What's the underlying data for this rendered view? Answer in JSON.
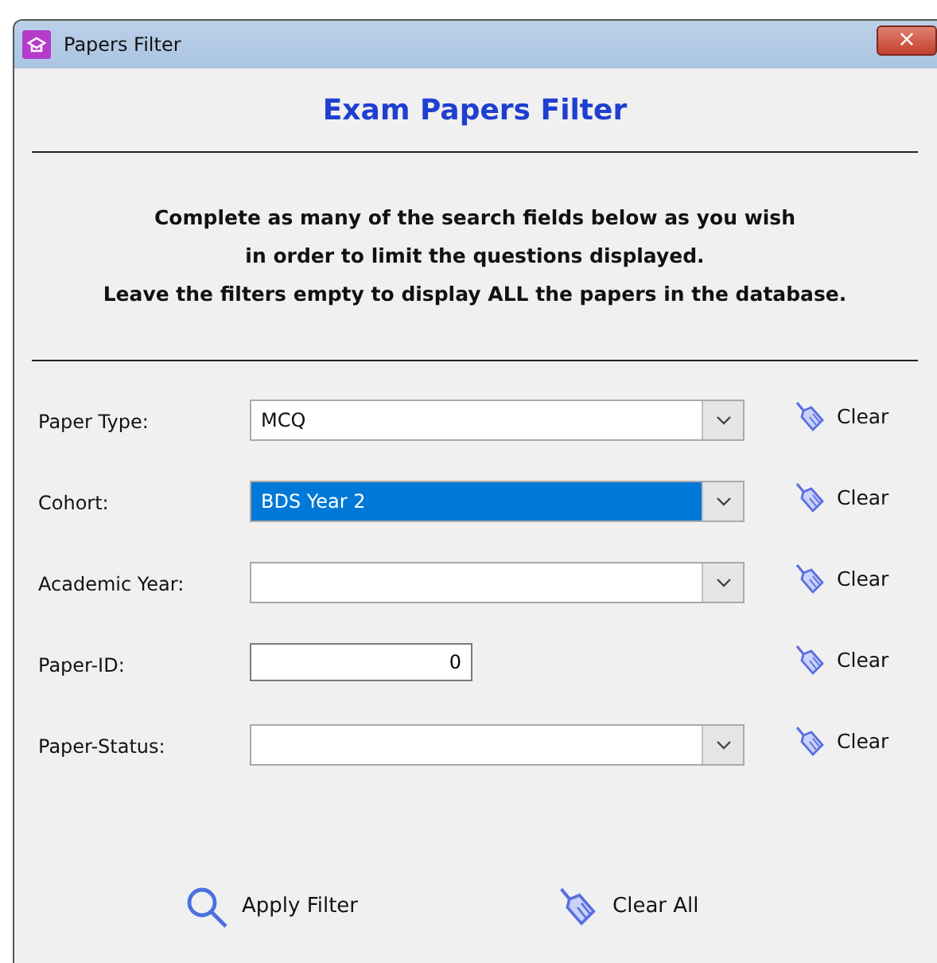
{
  "window": {
    "title": "Papers Filter",
    "close": "×"
  },
  "heading": "Exam Papers Filter",
  "instructions": [
    "Complete as many of the search fields below as you wish",
    "in order to limit the questions displayed.",
    "Leave the filters empty to display ALL the papers in the database."
  ],
  "fields": [
    {
      "label": "Paper Type:",
      "kind": "combo",
      "value": "MCQ",
      "selected": false,
      "clear": "Clear"
    },
    {
      "label": "Cohort:",
      "kind": "combo",
      "value": "BDS Year 2",
      "selected": true,
      "clear": "Clear"
    },
    {
      "label": "Academic Year:",
      "kind": "combo",
      "selected": false,
      "clear": "Clear"
    },
    {
      "label": "Paper-ID:",
      "kind": "number",
      "value": "0",
      "selected": false,
      "clear": "Clear"
    },
    {
      "label": "Paper-Status:",
      "kind": "combo",
      "selected": false,
      "clear": "Clear"
    }
  ],
  "buttons": [
    {
      "kind": "search",
      "label": "Apply Filter"
    },
    {
      "kind": "broom",
      "label": "Clear All"
    }
  ]
}
